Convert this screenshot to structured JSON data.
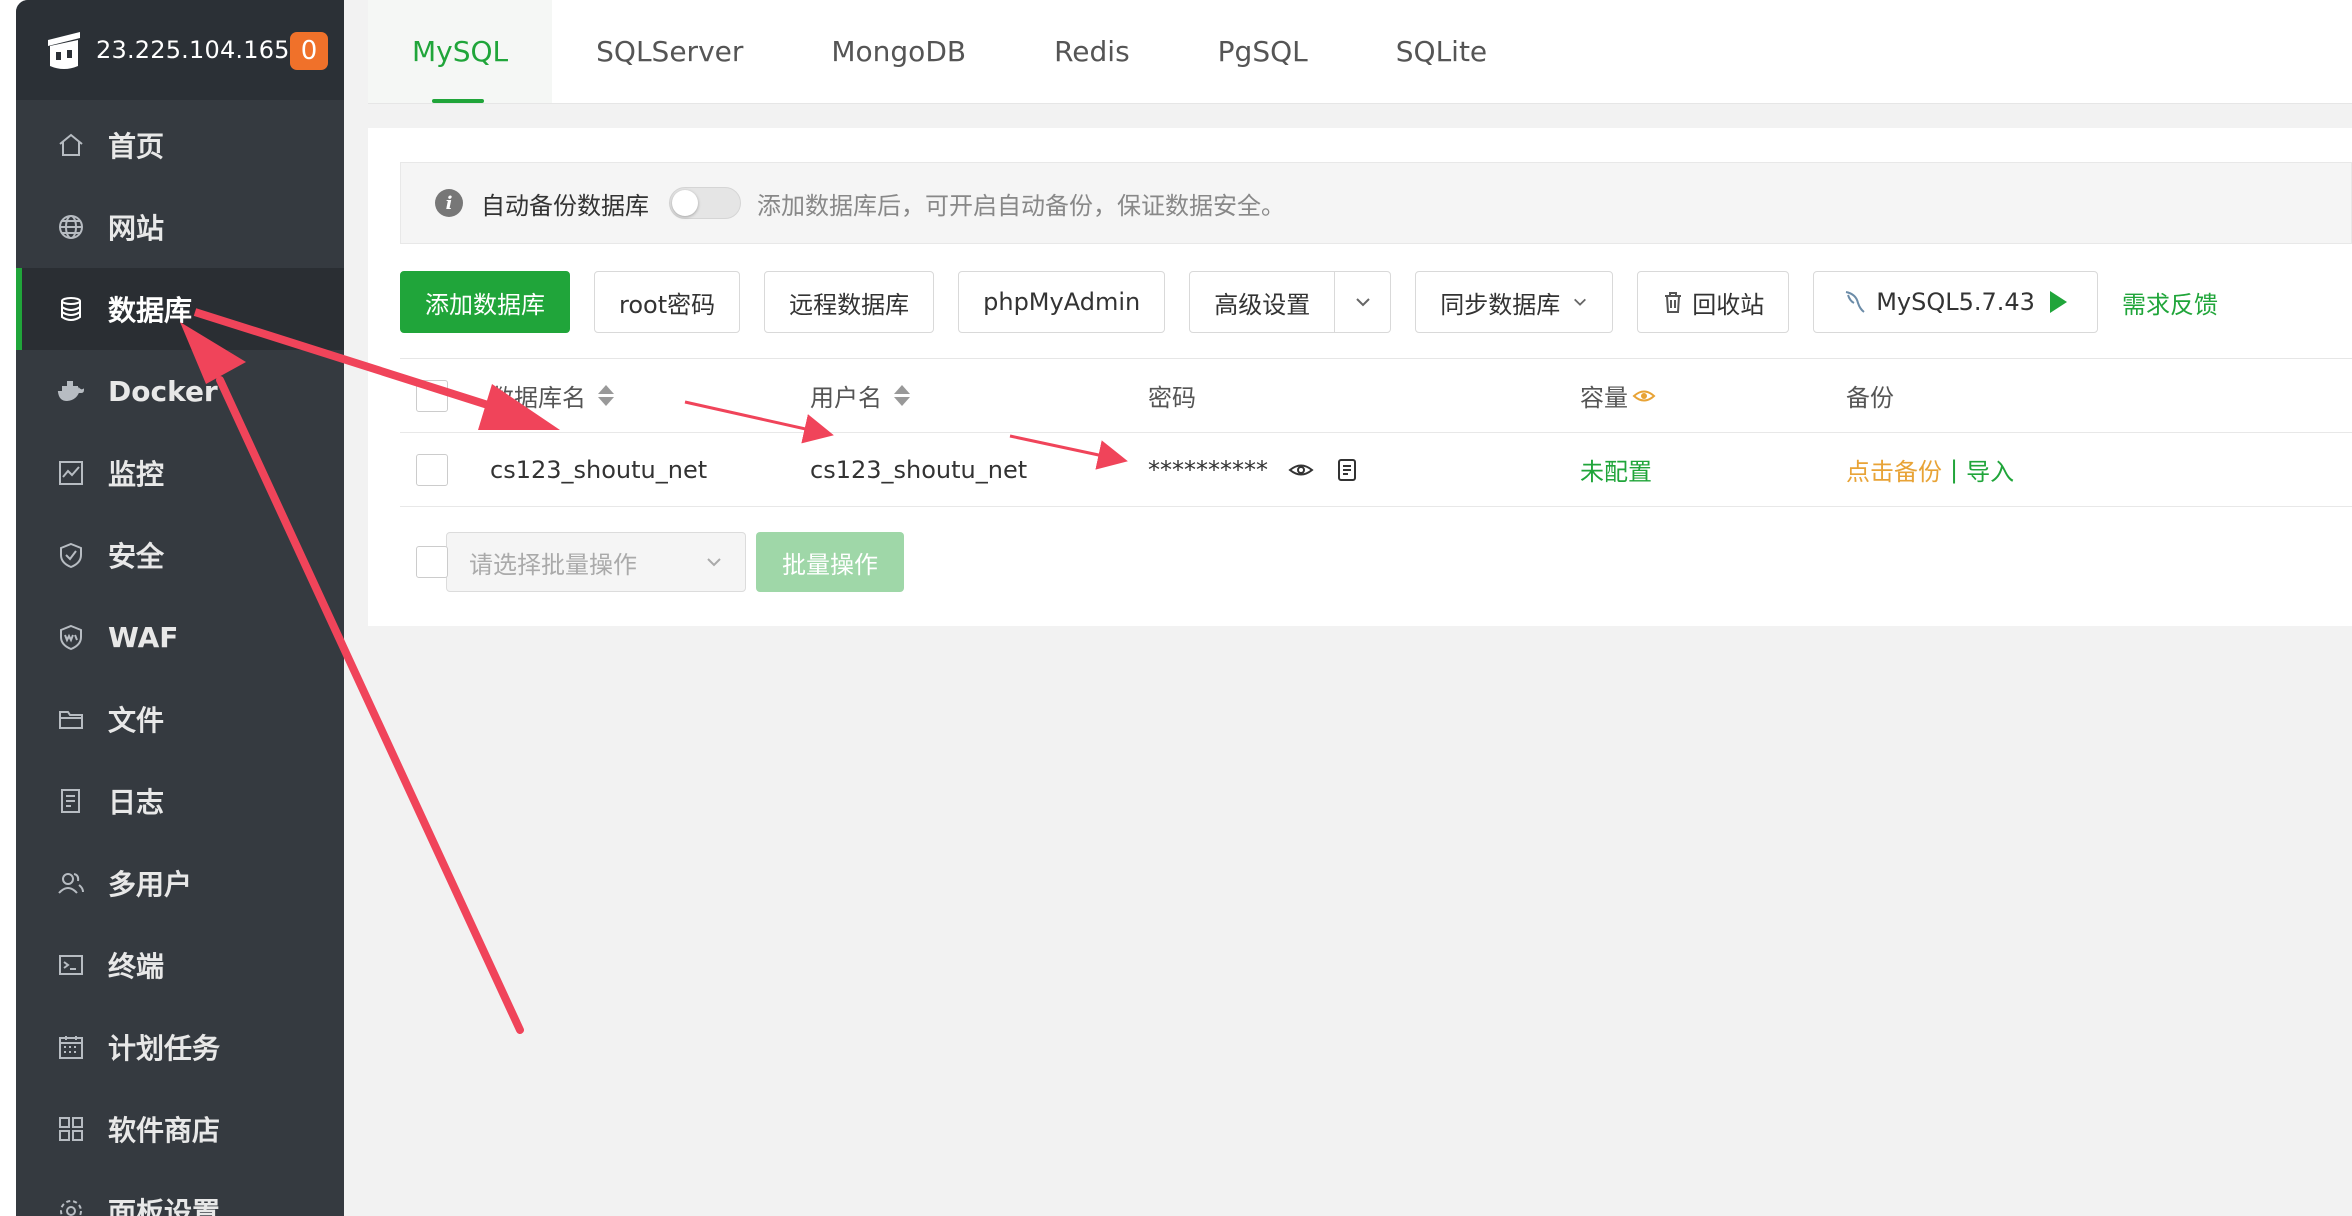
{
  "sidebar": {
    "ip": "23.225.104.165",
    "badge": "0",
    "items": [
      {
        "label": "首页",
        "icon": "home-icon"
      },
      {
        "label": "网站",
        "icon": "globe-icon"
      },
      {
        "label": "数据库",
        "icon": "database-icon",
        "active": true
      },
      {
        "label": "Docker",
        "icon": "docker-icon"
      },
      {
        "label": "监控",
        "icon": "monitor-icon"
      },
      {
        "label": "安全",
        "icon": "shield-icon"
      },
      {
        "label": "WAF",
        "icon": "waf-shield-icon"
      },
      {
        "label": "文件",
        "icon": "folder-icon"
      },
      {
        "label": "日志",
        "icon": "log-icon"
      },
      {
        "label": "多用户",
        "icon": "users-icon"
      },
      {
        "label": "终端",
        "icon": "terminal-icon"
      },
      {
        "label": "计划任务",
        "icon": "calendar-icon"
      },
      {
        "label": "软件商店",
        "icon": "apps-grid-icon"
      },
      {
        "label": "面板设置",
        "icon": "gear-icon"
      }
    ]
  },
  "tabs": [
    "MySQL",
    "SQLServer",
    "MongoDB",
    "Redis",
    "PgSQL",
    "SQLite"
  ],
  "notice": {
    "label": "自动备份数据库",
    "desc": "添加数据库后，可开启自动备份，保证数据安全。"
  },
  "toolbar": {
    "add_db": "添加数据库",
    "root_pwd": "root密码",
    "remote_db": "远程数据库",
    "phpmyadmin": "phpMyAdmin",
    "advanced": "高级设置",
    "sync_db": "同步数据库",
    "recycle": "回收站",
    "mysql_version": "MySQL5.7.43",
    "feedback": "需求反馈"
  },
  "table": {
    "headers": {
      "db_name": "数据库名",
      "username": "用户名",
      "password": "密码",
      "capacity": "容量",
      "backup": "备份"
    },
    "rows": [
      {
        "db_name": "cs123_shoutu_net",
        "username": "cs123_shoutu_net",
        "password": "**********",
        "capacity": "未配置",
        "backup_action": "点击备份",
        "separator": "|",
        "import_action": "导入"
      }
    ]
  },
  "batch": {
    "placeholder": "请选择批量操作",
    "button": "批量操作"
  },
  "colors": {
    "accent": "#20a53a",
    "sidebar_bg": "#353a40",
    "badge": "#f0712a",
    "arrow": "#f0445a"
  }
}
